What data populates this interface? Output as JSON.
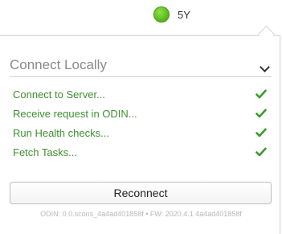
{
  "header": {
    "status_color": "#5cbc1e",
    "device_name": "5Y"
  },
  "panel": {
    "section_title": "Connect Locally",
    "steps": [
      {
        "label": "Connect to Server...",
        "status": "check-icon"
      },
      {
        "label": "Receive request in ODIN...",
        "status": "check-icon"
      },
      {
        "label": "Run Health checks...",
        "status": "check-icon"
      },
      {
        "label": "Fetch Tasks...",
        "status": "check-icon"
      }
    ],
    "reconnect_label": "Reconnect",
    "footer": "ODIN: 0.0.scons_4a4ad401858f • FW: 2020.4.1 4a4ad401858f"
  },
  "colors": {
    "step_text": "#3f8f2f",
    "check": "#3a9b2a"
  }
}
